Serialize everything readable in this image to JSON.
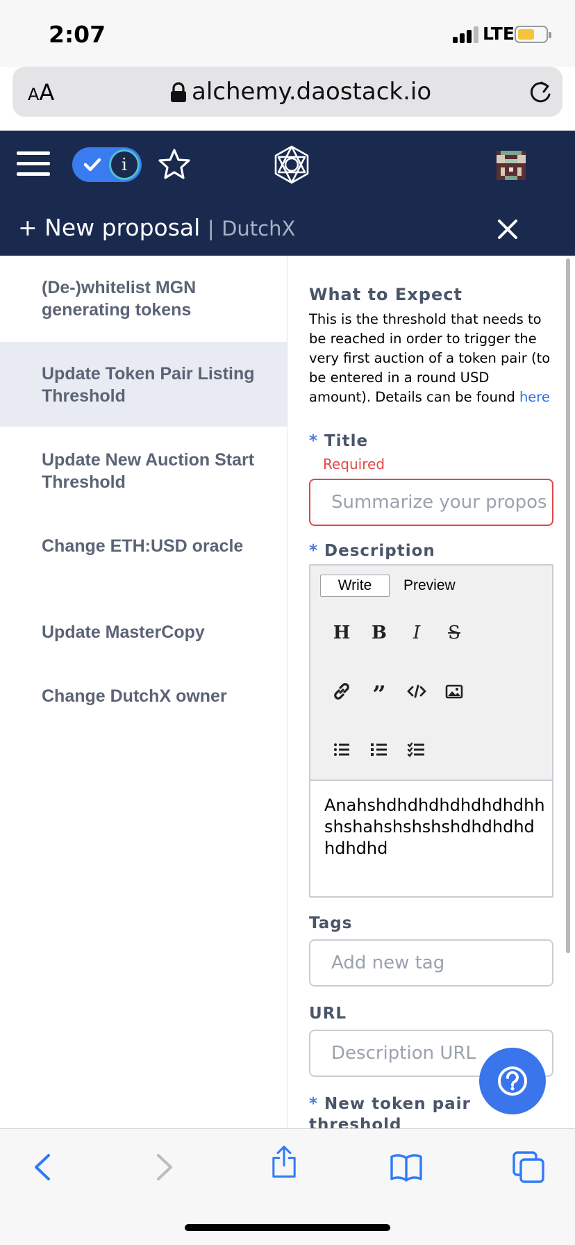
{
  "status_bar": {
    "time": "2:07",
    "network": "LTE",
    "battery_color": "#f5c43b"
  },
  "browser": {
    "text_size_label": "AA",
    "domain": "alchemy.daostack.io"
  },
  "header": {
    "new_proposal_label": "+ New proposal",
    "separator": "|",
    "scheme_name": "DutchX",
    "toggle_info_glyph": "i",
    "background_color": "#1a2a4f",
    "accent_color": "#3a7bef"
  },
  "sidebar": {
    "items": [
      {
        "label": "(De-)whitelist MGN generating tokens",
        "active": false
      },
      {
        "label": "Update Token Pair Listing Threshold",
        "active": true
      },
      {
        "label": "Update New Auction Start Threshold",
        "active": false
      },
      {
        "label": "Change ETH:USD oracle",
        "active": false
      },
      {
        "label": "Update MasterCopy",
        "active": false
      },
      {
        "label": "Change DutchX owner",
        "active": false
      }
    ]
  },
  "form": {
    "what_to_expect_heading": "What to Expect",
    "what_to_expect_text": "This is the threshold that needs to be reached in order to trigger the very first auction of a token pair (to be entered in a round USD amount). Details can be found",
    "what_to_expect_link": "here",
    "required_marker": "*",
    "title_label": "Title",
    "title_error": "Required",
    "title_placeholder": "Summarize your propos",
    "description_label": "Description",
    "editor": {
      "tab_write": "Write",
      "tab_preview": "Preview",
      "content": "Anahshdhdhdhdhdhdhdhh shshahshshshshdhdhdhd hdhdhd",
      "toolbar_icons": [
        "header-icon",
        "bold-icon",
        "italic-icon",
        "strikethrough-icon",
        "link-icon",
        "quote-icon",
        "code-icon",
        "image-icon",
        "unordered-list-icon",
        "ordered-list-icon",
        "checklist-icon"
      ]
    },
    "tags_label": "Tags",
    "tags_placeholder": "Add new tag",
    "url_label": "URL",
    "url_placeholder": "Description URL",
    "threshold_label": "New token pair threshold",
    "error_color": "#e04848"
  },
  "help_button": {
    "icon": "help-icon",
    "color": "#3a75ec"
  },
  "bottom_toolbar": {
    "icons": [
      "back-icon",
      "forward-icon",
      "share-icon",
      "bookmarks-icon",
      "tabs-icon"
    ]
  }
}
